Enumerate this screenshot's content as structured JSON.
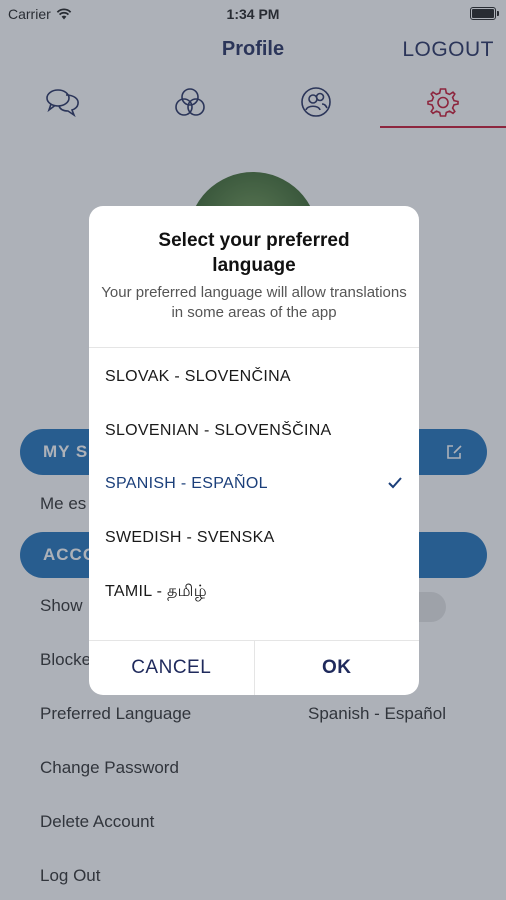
{
  "status_bar": {
    "carrier": "Carrier",
    "time": "1:34 PM"
  },
  "nav": {
    "title": "Profile",
    "logout_label": "LOGOUT"
  },
  "tabs": [
    {
      "icon": "chat-icon",
      "active": false
    },
    {
      "icon": "circles-icon",
      "active": false
    },
    {
      "icon": "contacts-icon",
      "active": false
    },
    {
      "icon": "gear-icon",
      "active": true
    }
  ],
  "profile": {
    "section_my": "MY S",
    "bio_text": "Me es",
    "section_account": "ACCO",
    "rows": {
      "show": "Show",
      "blocked": "Blocke",
      "preferred_language": "Preferred Language",
      "preferred_language_value": "Spanish - Español",
      "change_password": "Change Password",
      "delete_account": "Delete Account",
      "log_out": "Log Out"
    }
  },
  "dialog": {
    "title": "Select your preferred language",
    "message": "Your preferred language will allow translations in some areas of the app",
    "languages": [
      {
        "label": "SLOVAK - SLOVENČINA",
        "selected": false
      },
      {
        "label": "SLOVENIAN - SLOVENŠČINA",
        "selected": false
      },
      {
        "label": "SPANISH - ESPAÑOL",
        "selected": true
      },
      {
        "label": "SWEDISH - SVENSKA",
        "selected": false
      },
      {
        "label": "TAMIL - தமிழ்",
        "selected": false
      }
    ],
    "cancel_label": "CANCEL",
    "ok_label": "OK"
  },
  "colors": {
    "accent": "#1b6fb9",
    "nav_text": "#1f2a5c",
    "active_tab": "#c8102e"
  }
}
